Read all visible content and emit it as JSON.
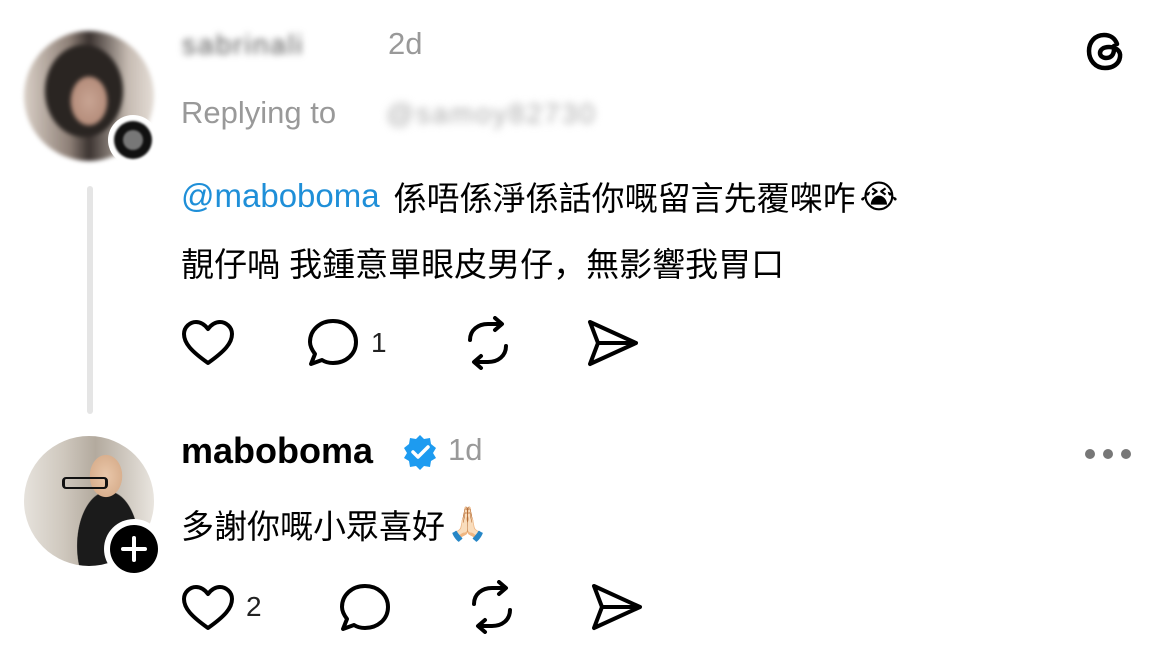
{
  "app": {
    "logo_icon": "threads-logo-icon"
  },
  "reply_comment": {
    "username": "sabrinali",
    "time": "2d",
    "replying_label": "Replying to",
    "replying_to": "@samoy82730",
    "mention": "@maboboma",
    "line1": "係唔係淨係話你嘅留言先覆㗎咋",
    "line1_emoji": "😭",
    "line2": "靚仔喎 我鍾意單眼皮男仔，無影響我胃口",
    "actions": {
      "reply_count": "1"
    }
  },
  "author_comment": {
    "username": "maboboma",
    "verified": true,
    "time": "1d",
    "text": "多謝你嘅小眾喜好",
    "emoji": "🙏🏻",
    "actions": {
      "like_count": "2"
    },
    "more_icon": "more-dots-icon"
  },
  "colors": {
    "mention": "#1f8fd8",
    "verified": "#1d9bf0",
    "muted": "#999999"
  }
}
